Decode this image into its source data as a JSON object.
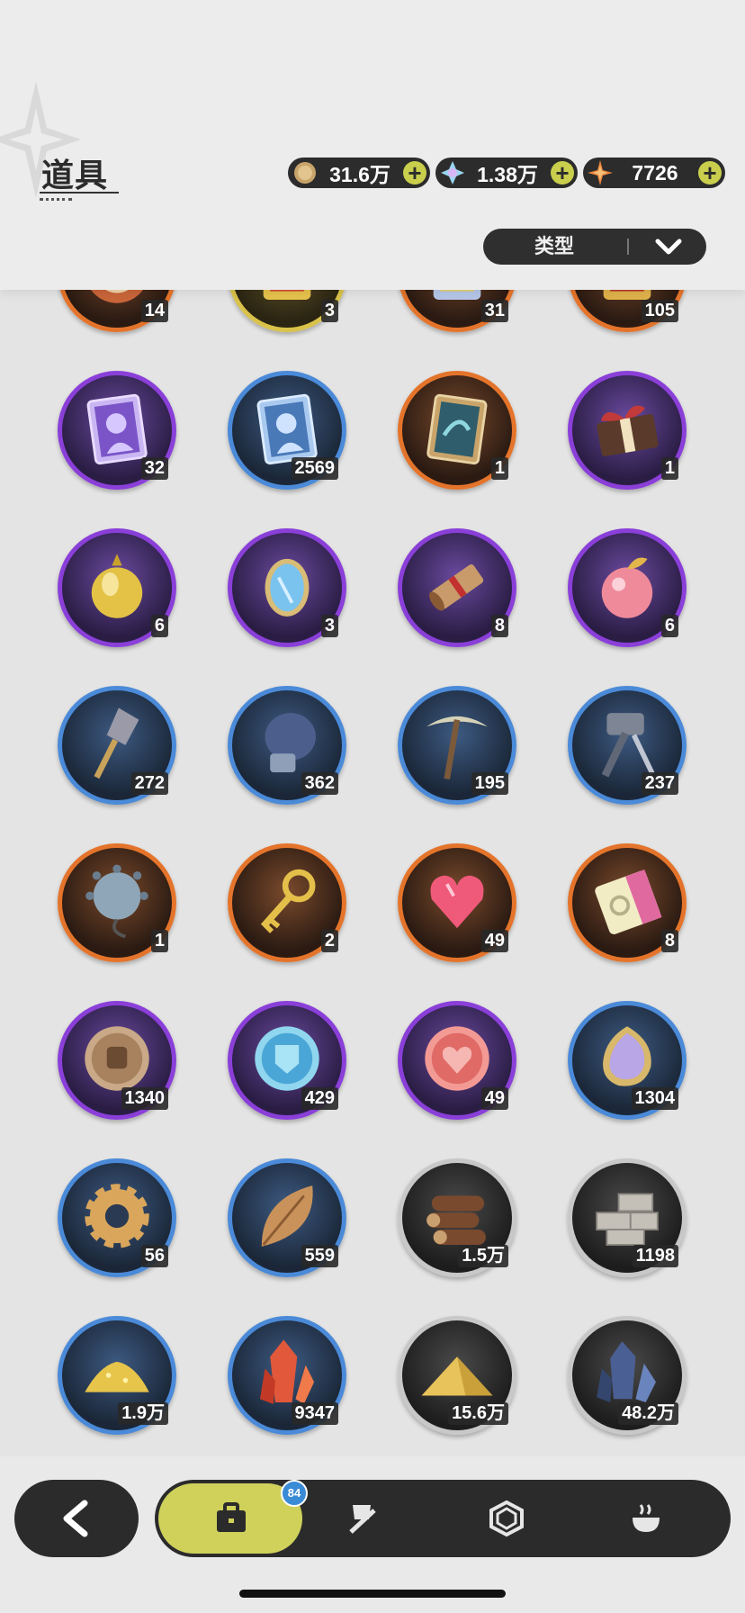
{
  "header": {
    "title": "道具",
    "currencies": [
      {
        "icon": "gold-coin-icon",
        "value": "31.6万"
      },
      {
        "icon": "crystal-icon",
        "value": "1.38万"
      },
      {
        "icon": "orange-star-icon",
        "value": "7726"
      }
    ],
    "filter_label": "类型"
  },
  "items": [
    {
      "icon": "orange-round-item-icon",
      "rarity": "orange",
      "count": "14"
    },
    {
      "icon": "gold-card-item-icon",
      "rarity": "gold",
      "count": "3"
    },
    {
      "icon": "holo-card-item-icon",
      "rarity": "orange",
      "count": "31"
    },
    {
      "icon": "red-card-item-icon",
      "rarity": "orange",
      "count": "105"
    },
    {
      "icon": "purple-character-card-icon",
      "rarity": "purple",
      "count": "32"
    },
    {
      "icon": "blue-character-card-icon",
      "rarity": "blue",
      "count": "2569"
    },
    {
      "icon": "teal-card-icon",
      "rarity": "orange",
      "count": "1"
    },
    {
      "icon": "gift-box-icon",
      "rarity": "purple",
      "count": "1"
    },
    {
      "icon": "golden-acorn-icon",
      "rarity": "purple",
      "count": "6"
    },
    {
      "icon": "magic-mirror-icon",
      "rarity": "purple",
      "count": "3"
    },
    {
      "icon": "scroll-icon",
      "rarity": "purple",
      "count": "8"
    },
    {
      "icon": "pink-apple-icon",
      "rarity": "purple",
      "count": "6"
    },
    {
      "icon": "shovel-icon",
      "rarity": "blue",
      "count": "272"
    },
    {
      "icon": "boxing-glove-icon",
      "rarity": "blue",
      "count": "362"
    },
    {
      "icon": "pickaxe-icon",
      "rarity": "blue",
      "count": "195"
    },
    {
      "icon": "hammer-icon",
      "rarity": "blue",
      "count": "237"
    },
    {
      "icon": "spiked-ball-icon",
      "rarity": "orange",
      "count": "1"
    },
    {
      "icon": "golden-key-icon",
      "rarity": "orange",
      "count": "2"
    },
    {
      "icon": "heart-gem-icon",
      "rarity": "orange",
      "count": "49"
    },
    {
      "icon": "ticket-icon",
      "rarity": "orange",
      "count": "8"
    },
    {
      "icon": "fist-coin-icon",
      "rarity": "purple",
      "count": "1340"
    },
    {
      "icon": "shield-coin-icon",
      "rarity": "purple",
      "count": "429"
    },
    {
      "icon": "heart-coin-icon",
      "rarity": "purple",
      "count": "49"
    },
    {
      "icon": "scale-mirror-icon",
      "rarity": "blue",
      "count": "1304"
    },
    {
      "icon": "gear-icon",
      "rarity": "blue",
      "count": "56"
    },
    {
      "icon": "leaf-icon",
      "rarity": "blue",
      "count": "559"
    },
    {
      "icon": "logs-icon",
      "rarity": "gray",
      "count": "1.5万"
    },
    {
      "icon": "stone-bricks-icon",
      "rarity": "gray",
      "count": "1198"
    },
    {
      "icon": "gold-dust-icon",
      "rarity": "blue",
      "count": "1.9万"
    },
    {
      "icon": "red-crystal-icon",
      "rarity": "blue",
      "count": "9347"
    },
    {
      "icon": "sand-pile-icon",
      "rarity": "gray",
      "count": "15.6万"
    },
    {
      "icon": "blue-ore-icon",
      "rarity": "gray",
      "count": "48.2万"
    }
  ],
  "nav": {
    "back": "back-arrow-icon",
    "tabs": [
      {
        "icon": "bag-icon",
        "active": true,
        "badge": "84"
      },
      {
        "icon": "equipment-icon",
        "active": false
      },
      {
        "icon": "gem-icon",
        "active": false
      },
      {
        "icon": "cooking-pot-icon",
        "active": false
      }
    ]
  }
}
